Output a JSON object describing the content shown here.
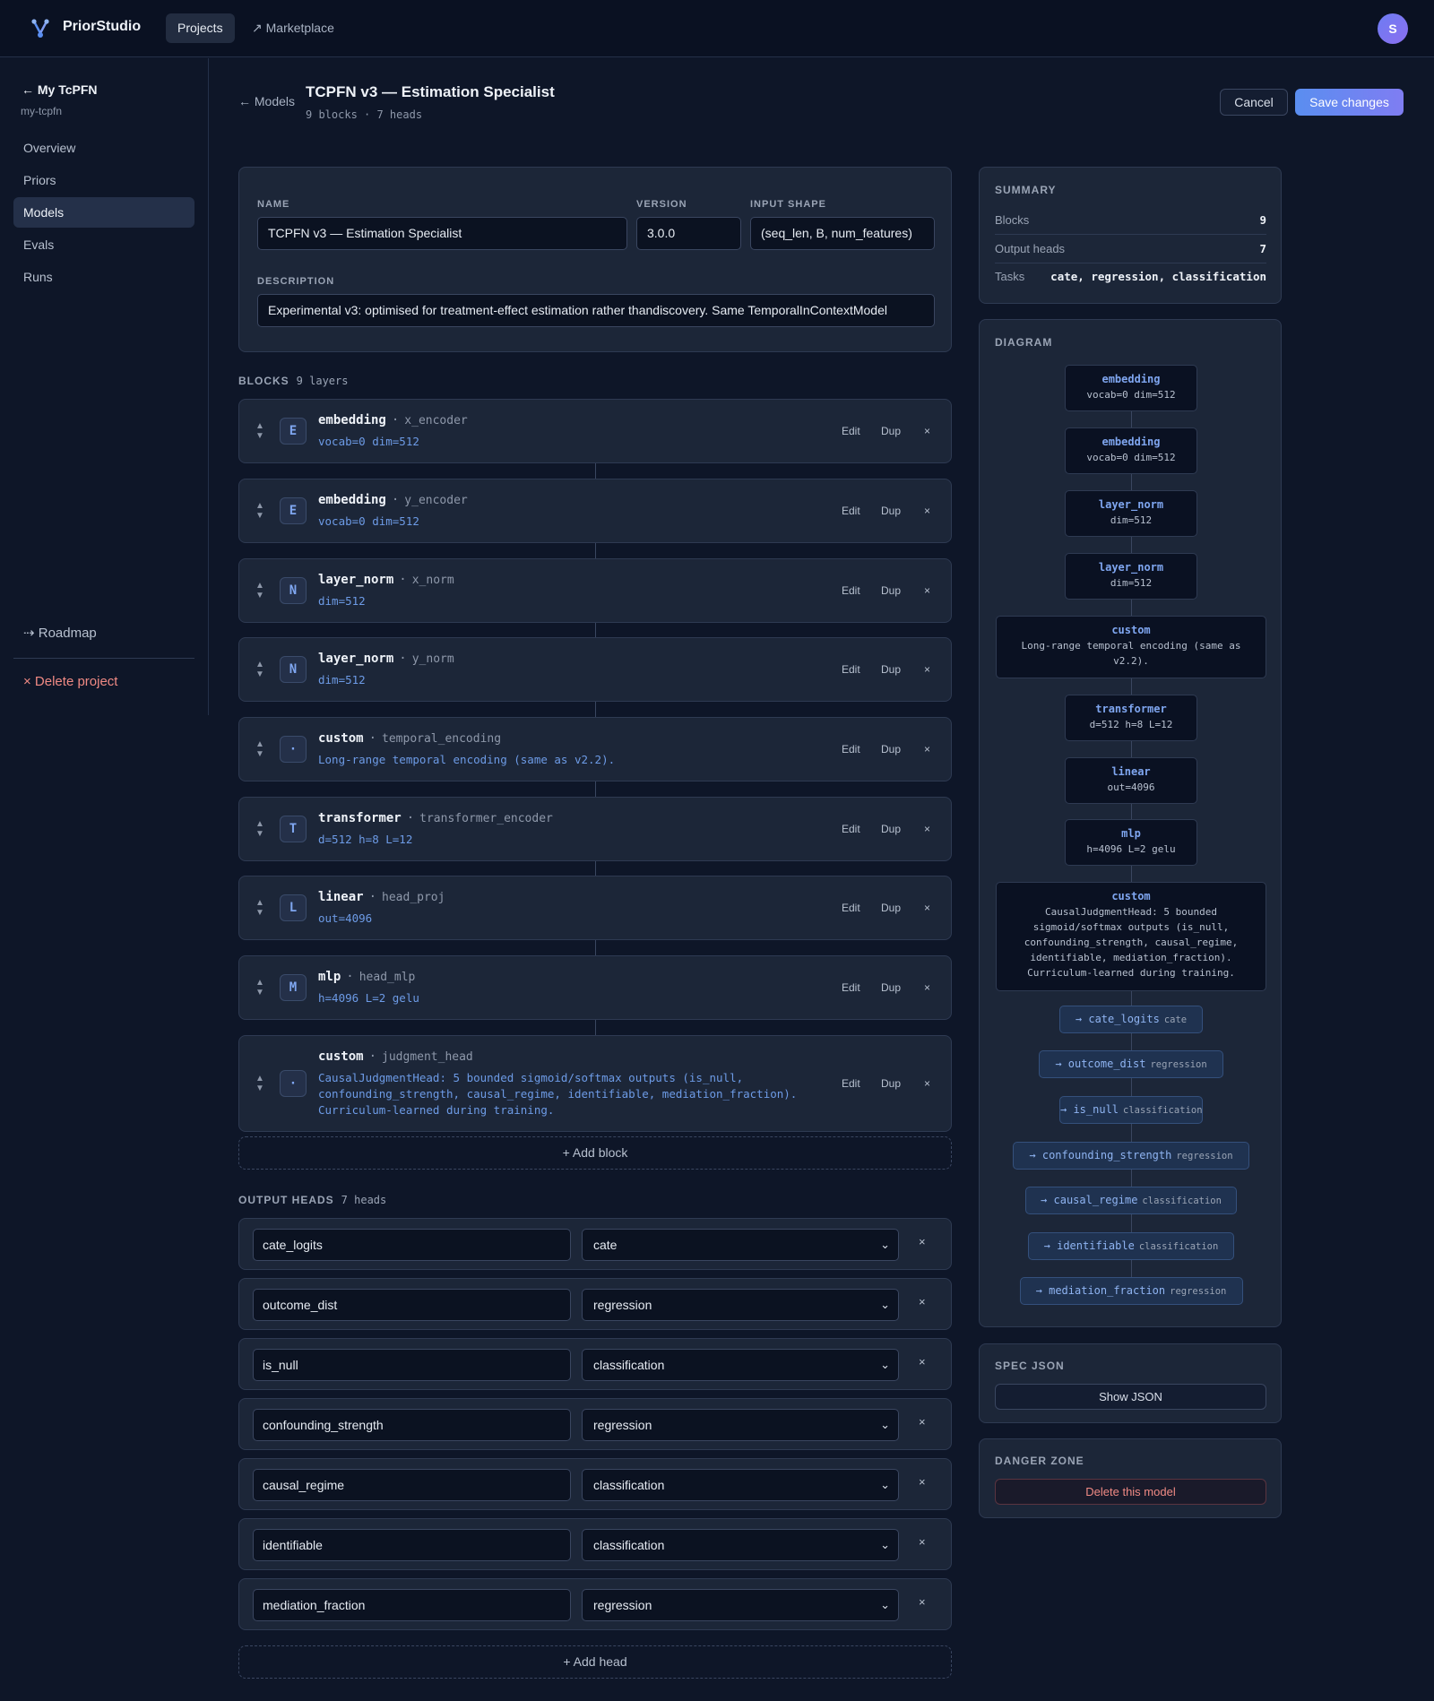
{
  "app": {
    "brand": "PriorStudio",
    "avatar_initial": "S"
  },
  "topnav": {
    "projects": "Projects",
    "marketplace": "↗ Marketplace"
  },
  "sidebar": {
    "back": "← My TcPFN",
    "slug": "my-tcpfn",
    "items": [
      "Overview",
      "Priors",
      "Models",
      "Evals",
      "Runs"
    ],
    "active": "Models",
    "roadmap": "⇢ Roadmap",
    "delete_project": "× Delete project"
  },
  "header": {
    "back": "← Models",
    "title": "TCPFN v3 — Estimation Specialist",
    "subtitle": "9 blocks · 7 heads",
    "cancel": "Cancel",
    "save": "Save changes"
  },
  "form": {
    "name_label": "NAME",
    "name_value": "TCPFN v3 — Estimation Specialist",
    "version_label": "VERSION",
    "version_value": "3.0.0",
    "shape_label": "INPUT SHAPE",
    "shape_value": "(seq_len, B, num_features)",
    "desc_label": "DESCRIPTION",
    "desc_value": "Experimental v3: optimised for treatment-effect estimation rather thandiscovery. Same TemporalInContextModel"
  },
  "blocks_section": {
    "label": "BLOCKS",
    "count": "9 layers"
  },
  "blocks": [
    {
      "badge": "E",
      "kind": "embedding",
      "name": "x_encoder",
      "params": [
        "vocab=0 dim=512"
      ]
    },
    {
      "badge": "E",
      "kind": "embedding",
      "name": "y_encoder",
      "params": [
        "vocab=0 dim=512"
      ]
    },
    {
      "badge": "N",
      "kind": "layer_norm",
      "name": "x_norm",
      "params": [
        "dim=512"
      ]
    },
    {
      "badge": "N",
      "kind": "layer_norm",
      "name": "y_norm",
      "params": [
        "dim=512"
      ]
    },
    {
      "badge": "·",
      "kind": "custom",
      "name": "temporal_encoding",
      "params": [
        "Long-range temporal encoding (same as v2.2)."
      ]
    },
    {
      "badge": "T",
      "kind": "transformer",
      "name": "transformer_encoder",
      "params": [
        "d=512 h=8 L=12"
      ]
    },
    {
      "badge": "L",
      "kind": "linear",
      "name": "head_proj",
      "params": [
        "out=4096"
      ]
    },
    {
      "badge": "M",
      "kind": "mlp",
      "name": "head_mlp",
      "params": [
        "h=4096 L=2 gelu"
      ]
    },
    {
      "badge": "·",
      "kind": "custom",
      "name": "judgment_head",
      "params": [
        "CausalJudgmentHead: 5 bounded sigmoid/softmax outputs (is_null,",
        "confounding_strength, causal_regime, identifiable, mediation_fraction).",
        "Curriculum-learned during training."
      ]
    }
  ],
  "block_actions": {
    "edit": "Edit",
    "dup": "Dup",
    "remove": "×",
    "sep": "·",
    "up": "▲",
    "down": "▼"
  },
  "add_block": "+ Add block",
  "heads_section": {
    "label": "OUTPUT HEADS",
    "count": "7 heads"
  },
  "heads": [
    {
      "name": "cate_logits",
      "task": "cate"
    },
    {
      "name": "outcome_dist",
      "task": "regression"
    },
    {
      "name": "is_null",
      "task": "classification"
    },
    {
      "name": "confounding_strength",
      "task": "regression"
    },
    {
      "name": "causal_regime",
      "task": "classification"
    },
    {
      "name": "identifiable",
      "task": "classification"
    },
    {
      "name": "mediation_fraction",
      "task": "regression"
    }
  ],
  "head_actions": {
    "remove": "×",
    "chevron": "⌄"
  },
  "add_head": "+ Add head",
  "summary": {
    "title": "SUMMARY",
    "rows": [
      {
        "label": "Blocks",
        "value": "9"
      },
      {
        "label": "Output heads",
        "value": "7"
      },
      {
        "label": "Tasks",
        "value": "cate, regression, classification"
      }
    ]
  },
  "diagram": {
    "title": "DIAGRAM",
    "nodes": [
      {
        "kind": "embedding",
        "params": [
          "vocab=0 dim=512"
        ]
      },
      {
        "kind": "embedding",
        "params": [
          "vocab=0 dim=512"
        ]
      },
      {
        "kind": "layer_norm",
        "params": [
          "dim=512"
        ]
      },
      {
        "kind": "layer_norm",
        "params": [
          "dim=512"
        ]
      },
      {
        "kind": "custom",
        "params": [
          "Long-range temporal encoding (same as",
          "v2.2)."
        ]
      },
      {
        "kind": "transformer",
        "params": [
          "d=512 h=8 L=12"
        ]
      },
      {
        "kind": "linear",
        "params": [
          "out=4096"
        ]
      },
      {
        "kind": "mlp",
        "params": [
          "h=4096 L=2 gelu"
        ]
      },
      {
        "kind": "custom",
        "params": [
          "CausalJudgmentHead: 5 bounded",
          "sigmoid/softmax outputs (is_null,",
          "confounding_strength, causal_regime,",
          "identifiable, mediation_fraction).",
          "Curriculum-learned during training."
        ]
      }
    ],
    "heads": [
      {
        "name": "→ cate_logits",
        "task": "cate"
      },
      {
        "name": "→ outcome_dist",
        "task": "regression"
      },
      {
        "name": "→ is_null",
        "task": "classification"
      },
      {
        "name": "→ confounding_strength",
        "task": "regression"
      },
      {
        "name": "→ causal_regime",
        "task": "classification"
      },
      {
        "name": "→ identifiable",
        "task": "classification"
      },
      {
        "name": "→ mediation_fraction",
        "task": "regression"
      }
    ]
  },
  "spec_json": {
    "title": "SPEC JSON",
    "button": "Show JSON"
  },
  "danger": {
    "title": "DANGER ZONE",
    "button": "Delete this model"
  },
  "colors": {
    "accent": "#5a8ef0",
    "danger": "#f08a84",
    "background": "#0e1628",
    "card": "#1c2638"
  },
  "icons": {
    "logo": "branch-logo-icon"
  }
}
